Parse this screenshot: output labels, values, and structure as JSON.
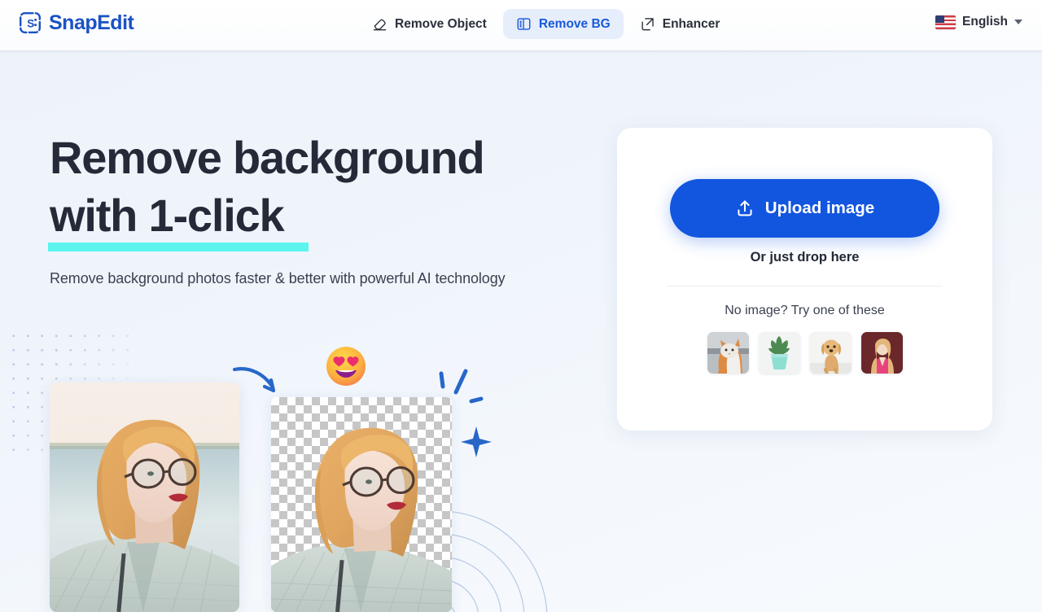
{
  "header": {
    "logo_text": "SnapEdit",
    "logo_icon": "snapedit-logo-icon",
    "nav": [
      {
        "label": "Remove Object",
        "icon": "eraser-icon",
        "active": false
      },
      {
        "label": "Remove BG",
        "icon": "remove-background-icon",
        "active": true
      },
      {
        "label": "Enhancer",
        "icon": "enhance-expand-icon",
        "active": false
      }
    ],
    "language": {
      "label": "English",
      "flag_icon": "us-flag-icon",
      "chevron_icon": "chevron-down-icon"
    }
  },
  "hero": {
    "title_line1": "Remove background",
    "title_line2": "with 1-click",
    "subtitle": "Remove background photos faster & better with powerful AI technology",
    "underline_color": "#5bf4ef"
  },
  "upload_card": {
    "upload_button_label": "Upload image",
    "upload_icon": "upload-arrow-icon",
    "drop_text": "Or just drop here",
    "sample_prompt": "No image? Try one of these",
    "samples": [
      {
        "name": "sample-cat",
        "alt": "orange and white cat"
      },
      {
        "name": "sample-plant",
        "alt": "succulent in teal pot"
      },
      {
        "name": "sample-dog",
        "alt": "golden puppy"
      },
      {
        "name": "sample-woman",
        "alt": "woman in pink top"
      }
    ],
    "accent_color": "#1256e0"
  },
  "showcase": {
    "before_image_alt": "blonde woman with glasses by the water",
    "after_image_alt": "same portrait with background removed on transparency checkerboard",
    "decorations": [
      "curved-arrow-icon",
      "heart-eyes-emoji",
      "sparkle-icon",
      "dash-marks-icon",
      "dot-grid",
      "concentric-arcs"
    ]
  }
}
